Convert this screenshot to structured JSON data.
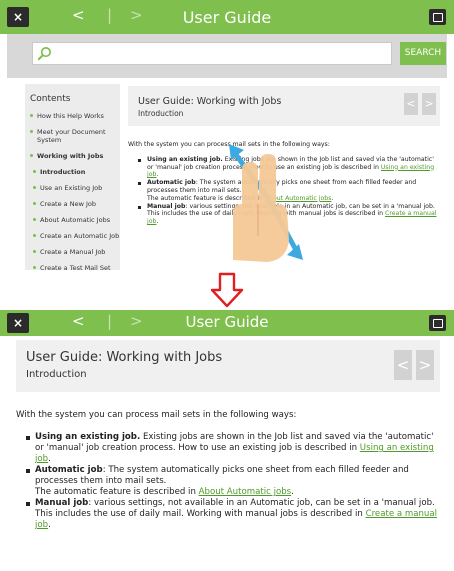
{
  "window": {
    "title": "User Guide"
  },
  "toolbar": {
    "close": "×",
    "back": "<",
    "separator": "|",
    "forward": ">"
  },
  "search": {
    "placeholder": "",
    "button": "SEARCH"
  },
  "sidebar": {
    "heading": "Contents",
    "items": [
      {
        "label": "How this Help Works"
      },
      {
        "label": "Meet your Document System"
      },
      {
        "label": "Working with Jobs"
      },
      {
        "label": "Introduction"
      },
      {
        "label": "Use an Existing Job"
      },
      {
        "label": "Create a New Job"
      },
      {
        "label": "About Automatic Jobs"
      },
      {
        "label": "Create an Automatic Job"
      },
      {
        "label": "Create a Manual Job"
      },
      {
        "label": "Create a Test Mail Set"
      }
    ]
  },
  "page": {
    "title": "User Guide: Working with Jobs",
    "subtitle": "Introduction",
    "intro": "With the system you can process mail sets in the following ways:",
    "items": [
      {
        "lead": "Using an existing job.",
        "text": " Existing jobs are shown in the Job list and saved via the 'automatic' or 'manual' job creation process. How to use an existing job is described in ",
        "link": "Using an existing job",
        "end": "."
      },
      {
        "lead": "Automatic job",
        "text": ": The system automatically picks one sheet from each filled feeder and processes them into mail sets.",
        "note": "The automatic feature is described in ",
        "link": "About Automatic jobs",
        "end": "."
      },
      {
        "lead": "Manual job",
        "text": ": various settings, not available in an Automatic job, can be set in a 'manual job. This includes the use of daily mail. Working with manual jobs is described in ",
        "link": "Create a manual job",
        "end": "."
      }
    ]
  },
  "colors": {
    "accent": "#7fbf4d",
    "arrow": "#e02020",
    "gesture": "#3ea8e0"
  },
  "icons": {
    "search": "search-icon",
    "exit": "exit-icon",
    "gesture": "two-finger-swipe-icon",
    "transition": "down-arrow-icon"
  }
}
